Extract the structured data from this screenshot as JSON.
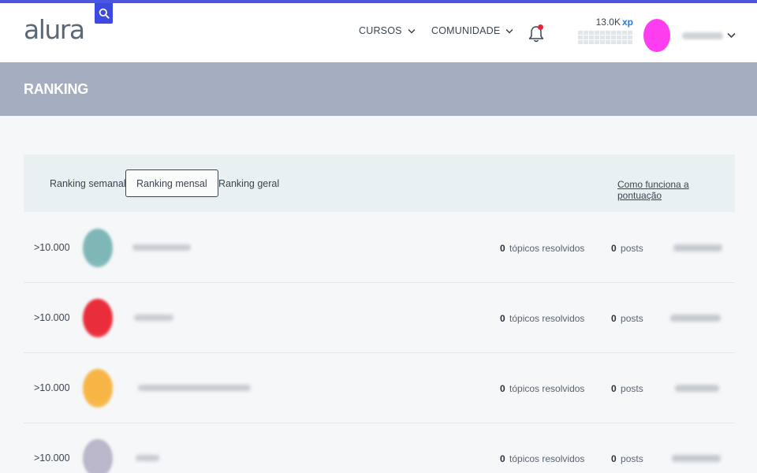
{
  "header": {
    "logo": "alura",
    "nav": [
      {
        "label": "CURSOS"
      },
      {
        "label": "COMUNIDADE"
      }
    ],
    "xp": {
      "value": "13.0K",
      "unit": "xp"
    },
    "brand_color": "#3c4ae0",
    "avatar_color": "#ff3df0"
  },
  "page": {
    "title": "RANKING"
  },
  "tabs": {
    "items": [
      "Ranking semanal",
      "Ranking mensal",
      "Ranking geral"
    ],
    "active": "Ranking mensal",
    "how_link": "Como funciona a pontuação"
  },
  "ranking": {
    "rows": [
      {
        "rank": ">10.000",
        "topics": "0",
        "topics_label": "tópicos resolvidos",
        "posts": "0",
        "posts_label": "posts",
        "avatar_color": "#7fb7b6"
      },
      {
        "rank": ">10.000",
        "topics": "0",
        "topics_label": "tópicos resolvidos",
        "posts": "0",
        "posts_label": "posts",
        "avatar_color": "#ea2d3a"
      },
      {
        "rank": ">10.000",
        "topics": "0",
        "topics_label": "tópicos resolvidos",
        "posts": "0",
        "posts_label": "posts",
        "avatar_color": "#f7b546"
      },
      {
        "rank": ">10.000",
        "topics": "0",
        "topics_label": "tópicos resolvidos",
        "posts": "0",
        "posts_label": "posts",
        "avatar_color": "#b9b7c9"
      }
    ]
  }
}
